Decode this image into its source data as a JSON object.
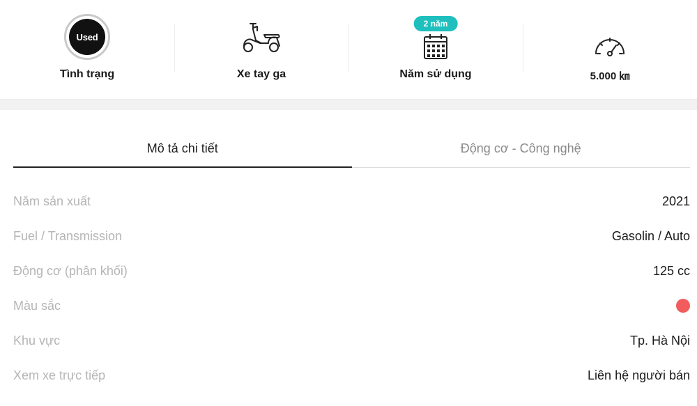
{
  "summary": {
    "condition": {
      "badge": "Used",
      "label": "Tình trạng"
    },
    "type": {
      "icon": "scooter-icon",
      "label": "Xe tay ga"
    },
    "years": {
      "pill": "2 năm",
      "icon": "calendar-icon",
      "label": "Năm sử dụng"
    },
    "mileage": {
      "icon": "speedometer-icon",
      "label": "5.000 ㎞"
    }
  },
  "tabs": [
    {
      "label": "Mô tả chi tiết"
    },
    {
      "label": "Động cơ - Công nghệ"
    }
  ],
  "specs": [
    {
      "key": "Năm sản xuất",
      "value": "2021"
    },
    {
      "key": "Fuel / Transmission",
      "value": "Gasolin / Auto"
    },
    {
      "key": "Động cơ (phân khối)",
      "value": "125 cc"
    },
    {
      "key": "Màu sắc",
      "color": "#f25c5c"
    },
    {
      "key": "Khu vực",
      "value": "Tp. Hà Nội"
    },
    {
      "key": "Xem xe trực tiếp",
      "value": "Liên hệ người bán"
    }
  ],
  "colors": {
    "accent": "#1fbfbd"
  }
}
